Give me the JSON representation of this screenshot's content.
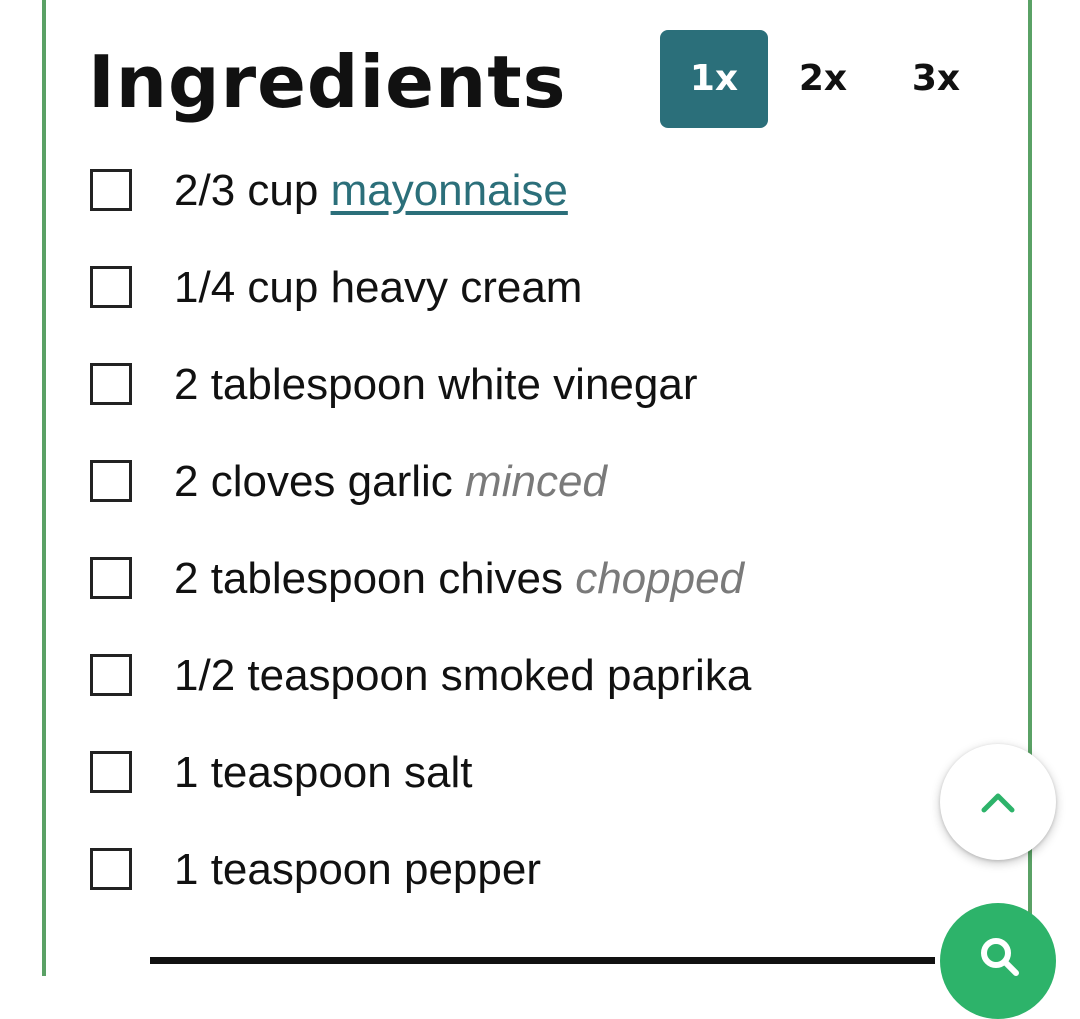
{
  "section": {
    "title": "Ingredients"
  },
  "scale_options": [
    {
      "label": "1x",
      "selected": true
    },
    {
      "label": "2x",
      "selected": false
    },
    {
      "label": "3x",
      "selected": false
    }
  ],
  "ingredients": [
    {
      "amount": "2/3 cup",
      "name": "mayonnaise",
      "note": "",
      "is_link": true
    },
    {
      "amount": "1/4 cup",
      "name": "heavy cream",
      "note": "",
      "is_link": false
    },
    {
      "amount": "2 tablespoon",
      "name": "white vinegar",
      "note": "",
      "is_link": false
    },
    {
      "amount": "2 cloves",
      "name": "garlic",
      "note": "minced",
      "is_link": false
    },
    {
      "amount": "2 tablespoon",
      "name": "chives",
      "note": "chopped",
      "is_link": false
    },
    {
      "amount": "1/2 teaspoon",
      "name": "smoked paprika",
      "note": "",
      "is_link": false
    },
    {
      "amount": "1 teaspoon",
      "name": "salt",
      "note": "",
      "is_link": false
    },
    {
      "amount": "1 teaspoon",
      "name": "pepper",
      "note": "",
      "is_link": false
    }
  ],
  "icons": {
    "scroll_top": "chevron-up-icon",
    "search": "search-icon"
  },
  "colors": {
    "accent": "#2b6f7a",
    "border": "#5aa165",
    "fab_green": "#2db36a",
    "note_gray": "#7a7a7a"
  }
}
